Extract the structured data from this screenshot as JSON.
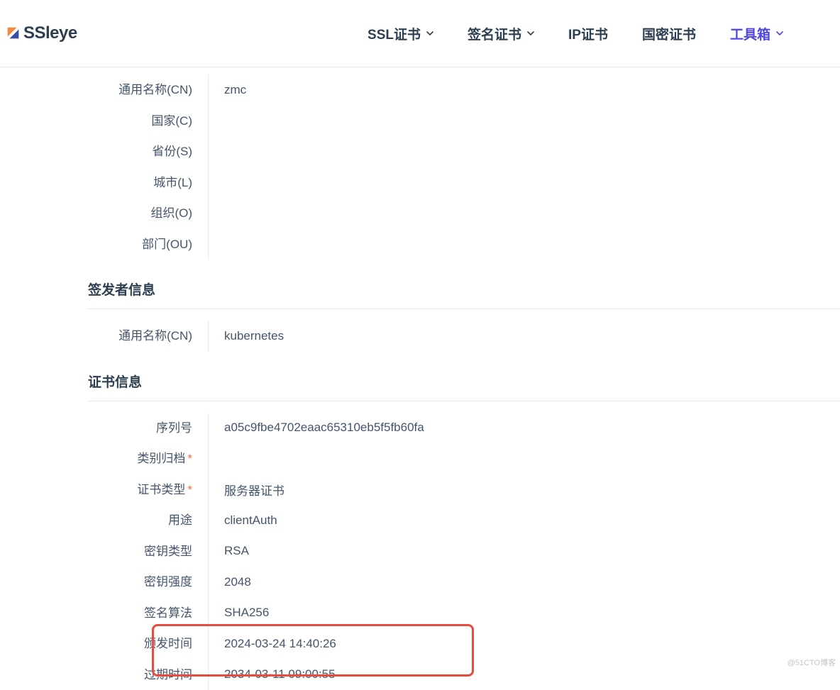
{
  "brand": "SSleye",
  "nav": {
    "ssl_cert": "SSL证书",
    "sign_cert": "签名证书",
    "ip_cert": "IP证书",
    "gm_cert": "国密证书",
    "toolbox": "工具箱"
  },
  "subject": {
    "rows": [
      {
        "label": "通用名称(CN)",
        "value": "zmc"
      },
      {
        "label": "国家(C)",
        "value": ""
      },
      {
        "label": "省份(S)",
        "value": ""
      },
      {
        "label": "城市(L)",
        "value": ""
      },
      {
        "label": "组织(O)",
        "value": ""
      },
      {
        "label": "部门(OU)",
        "value": ""
      }
    ]
  },
  "issuer": {
    "title": "签发者信息",
    "rows": [
      {
        "label": "通用名称(CN)",
        "value": "kubernetes"
      }
    ]
  },
  "certinfo": {
    "title": "证书信息",
    "rows": [
      {
        "label": "序列号",
        "value": "a05c9fbe4702eaac65310eb5f5fb60fa",
        "asterisk": false
      },
      {
        "label": "类别归档",
        "value": "",
        "asterisk": true
      },
      {
        "label": "证书类型",
        "value": "服务器证书",
        "asterisk": true
      },
      {
        "label": "用途",
        "value": "clientAuth",
        "asterisk": false
      },
      {
        "label": "密钥类型",
        "value": "RSA",
        "asterisk": false
      },
      {
        "label": "密钥强度",
        "value": "2048",
        "asterisk": false
      },
      {
        "label": "签名算法",
        "value": "SHA256",
        "asterisk": false
      },
      {
        "label": "颁发时间",
        "value": "2024-03-24 14:40:26",
        "asterisk": false
      },
      {
        "label": "过期时间",
        "value": "2034-03-11 09:00:55",
        "asterisk": false
      }
    ]
  },
  "watermark": "@51CTO博客"
}
